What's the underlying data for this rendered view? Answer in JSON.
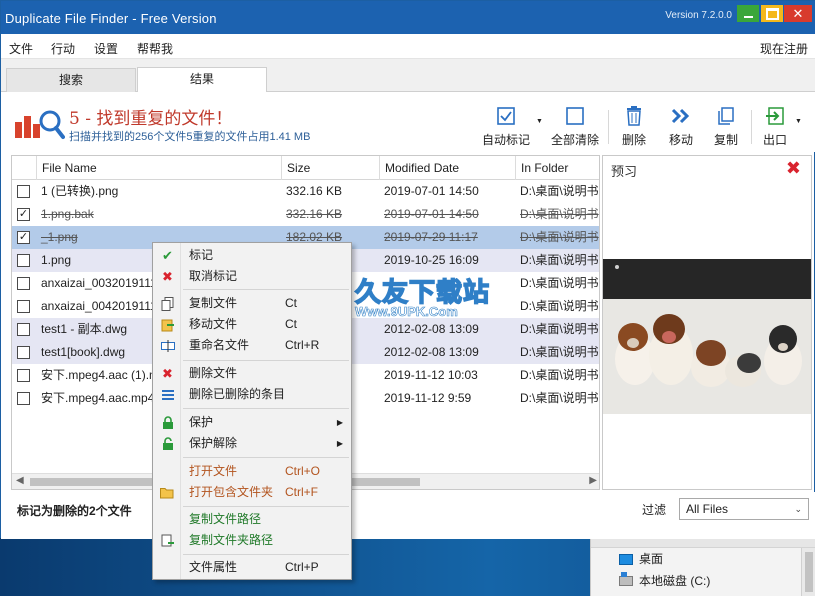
{
  "window": {
    "title": "Duplicate File Finder - Free Version",
    "version": "Version 7.2.0.0"
  },
  "menu": {
    "file": "文件",
    "action": "行动",
    "settings": "设置",
    "help": "帮帮我",
    "register": "现在注册"
  },
  "tabs": [
    {
      "label": "搜索"
    },
    {
      "label": "结果"
    }
  ],
  "header": {
    "headline": "5 - 找到重复的文件！",
    "subline": "扫描并找到的256个文件5重复的文件占用1.41 MB"
  },
  "toolbar": {
    "auto_mark": "自动标记",
    "clear_all": "全部清除",
    "delete": "删除",
    "move": "移动",
    "copy": "复制",
    "export": "出口"
  },
  "table": {
    "columns": [
      "File Name",
      "Size",
      "Modified Date",
      "In Folder"
    ],
    "rows": [
      {
        "checked": false,
        "name": "1 (已转换).png",
        "size": "332.16 KB",
        "date": "2019-07-01 14:50",
        "folder": "D:\\桌面\\说明书",
        "state": "normal"
      },
      {
        "checked": true,
        "name": "1.png.bak",
        "size": "332.16 KB",
        "date": "2019-07-01 14:50",
        "folder": "D:\\桌面\\说明书",
        "state": "struck"
      },
      {
        "checked": true,
        "name": "_1.png",
        "size": "182.02 KB",
        "date": "2019-07-29 11:17",
        "folder": "D:\\桌面\\说明书",
        "state": "selected"
      },
      {
        "checked": false,
        "name": "1.png",
        "size": "182.02 KB",
        "date": "2019-10-25 16:09",
        "folder": "D:\\桌面\\说明书",
        "state": "shaded"
      },
      {
        "checked": false,
        "name": "anxaizai_0032019111609",
        "size": "",
        "date": "",
        "folder": "D:\\桌面\\说明书",
        "state": "normal"
      },
      {
        "checked": false,
        "name": "anxaizai_0042019111609",
        "size": "",
        "date": "",
        "folder": "D:\\桌面\\说明书",
        "state": "normal"
      },
      {
        "checked": false,
        "name": "test1 - 副本.dwg",
        "size": "",
        "date": "2012-02-08 13:09",
        "folder": "D:\\桌面\\说明书",
        "state": "shaded"
      },
      {
        "checked": false,
        "name": "test1[book].dwg",
        "size": "",
        "date": "2012-02-08 13:09",
        "folder": "D:\\桌面\\说明书",
        "state": "shaded"
      },
      {
        "checked": false,
        "name": "安下.mpeg4.aac (1).mp4",
        "size": "",
        "date": "2019-11-12 10:03",
        "folder": "D:\\桌面\\说明书",
        "state": "normal"
      },
      {
        "checked": false,
        "name": "安下.mpeg4.aac.mp4",
        "size": "",
        "date": "2019-11-12 9:59",
        "folder": "D:\\桌面\\说明书",
        "state": "normal"
      }
    ]
  },
  "preview": {
    "title": "预习",
    "close_glyph": "✖"
  },
  "footer": {
    "status": "标记为删除的2个文件",
    "filter_label": "过滤",
    "filter_value": "All Files"
  },
  "context_menu": {
    "mark": "标记",
    "unmark": "取消标记",
    "copy_file": "复制文件",
    "copy_file_sc": "Ct",
    "move_file": "移动文件",
    "move_file_sc": "Ct",
    "rename_file": "重命名文件",
    "rename_file_sc": "Ctrl+R",
    "delete_file": "删除文件",
    "delete_removed": "删除已删除的条目",
    "protect": "保护",
    "unprotect": "保护解除",
    "open_file": "打开文件",
    "open_file_sc": "Ctrl+O",
    "open_folder": "打开包含文件夹",
    "open_folder_sc": "Ctrl+F",
    "copy_path": "复制文件路径",
    "copy_folder_path": "复制文件夹路径",
    "properties": "文件属性",
    "properties_sc": "Ctrl+P"
  },
  "watermark": {
    "brand": "久友下载站",
    "url": "Www.9UPK.Com",
    "small": "www.9UPK.com"
  },
  "explorer_panel": {
    "desktop": "桌面",
    "local_disk": "本地磁盘 (C:)"
  },
  "colors": {
    "titlebar": "#1c62b0",
    "headline": "#c0392b",
    "selected_row": "#b3cbe9",
    "shaded_row": "#e5e6f3",
    "close_red": "#d9232e"
  }
}
